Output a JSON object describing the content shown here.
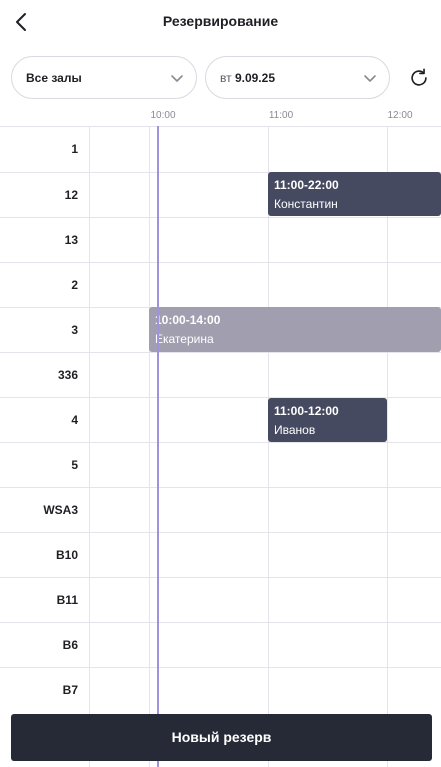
{
  "header": {
    "title": "Резервирование",
    "back_icon": "chevron-left-icon"
  },
  "filters": {
    "hall": "Все залы",
    "date_weekday": "вт",
    "date_value": "9.09.25",
    "refresh_icon": "refresh-icon"
  },
  "timeline": {
    "ticks": [
      "10:00",
      "11:00",
      "12:00"
    ]
  },
  "rows": [
    "1",
    "12",
    "13",
    "2",
    "3",
    "336",
    "4",
    "5",
    "WSA3",
    "B10",
    "B11",
    "B6",
    "B7"
  ],
  "reservations": [
    {
      "row": "12",
      "time": "11:00-22:00",
      "name": "Константин",
      "style": "dark"
    },
    {
      "row": "3",
      "time": "10:00-14:00",
      "name": "Екатерина",
      "style": "light"
    },
    {
      "row": "4",
      "time": "11:00-12:00",
      "name": "Иванов",
      "style": "dark"
    }
  ],
  "actions": {
    "new_reservation": "Новый резерв"
  },
  "colors": {
    "now_line": "#9e93dd",
    "reservation_dark": "#454a60",
    "reservation_light": "#a19faf",
    "button_bg": "#262a36"
  }
}
